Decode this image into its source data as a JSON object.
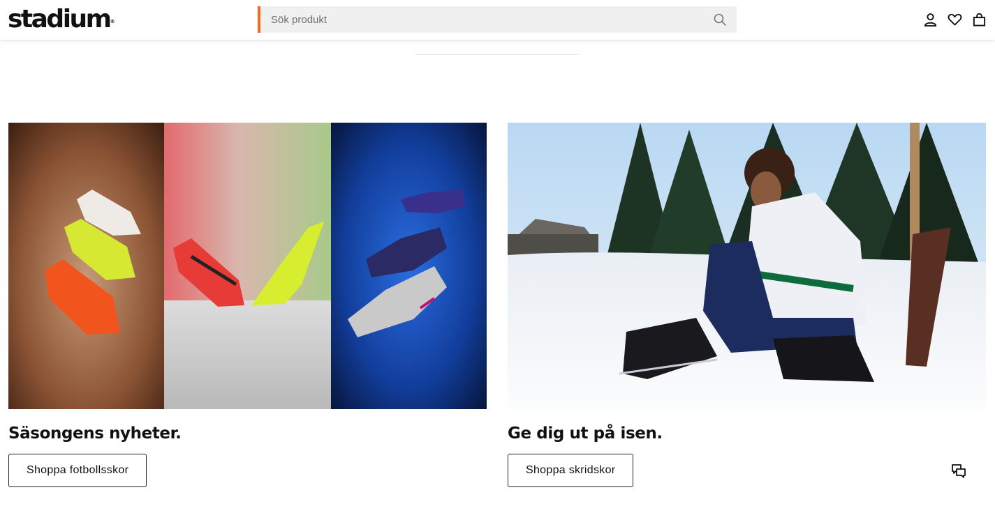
{
  "header": {
    "logo_text": "stadium",
    "logo_mark": "®",
    "search_placeholder": "Sök produkt",
    "icons": [
      "search-icon",
      "account-icon",
      "heart-icon",
      "bag-icon"
    ],
    "accent_color": "#f26c1f"
  },
  "promos": [
    {
      "title": "Säsongens nyheter.",
      "button": "Shoppa fotbollsskor",
      "image": "football boots in three panels"
    },
    {
      "title": "Ge dig ut på isen.",
      "button": "Shoppa skridskor",
      "image": "child lacing ice skates on snow"
    }
  ],
  "chat_icon": "chat-icon"
}
